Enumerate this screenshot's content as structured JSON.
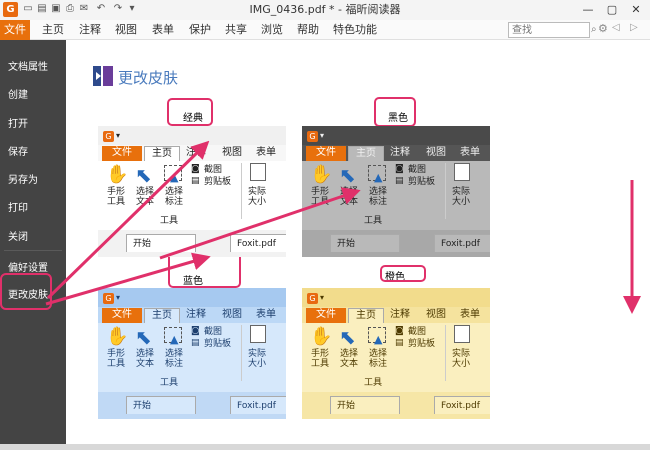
{
  "window": {
    "title": "IMG_0436.pdf * - 福昕阅读器",
    "logo": "G",
    "qa_icons": [
      "document-icon",
      "folder-icon",
      "save-icon",
      "print-icon",
      "email-icon",
      "undo-icon",
      "redo-icon",
      "dropdown-icon"
    ],
    "controls": [
      "minimize",
      "maximize",
      "close"
    ]
  },
  "menubar": {
    "file_label": "文件",
    "items": [
      "主页",
      "注释",
      "视图",
      "表单",
      "保护",
      "共享",
      "浏览",
      "帮助",
      "特色功能"
    ],
    "search_placeholder": "查找",
    "gear": "⚙"
  },
  "sidebar": {
    "items": [
      "文档属性",
      "创建",
      "打开",
      "保存",
      "另存为",
      "打印",
      "关闭",
      "偏好设置",
      "更改皮肤"
    ],
    "selected": "更改皮肤"
  },
  "page": {
    "title": "更改皮肤"
  },
  "skins": [
    {
      "name": "经典",
      "top_bg": "#f0f0f0",
      "tab_bg": "#f7f7f7",
      "ribbon_bg": "#ffffff",
      "bot_bg": "#f2f2f2",
      "text": "#222222",
      "home_bg": "#ffffff"
    },
    {
      "name": "黑色",
      "top_bg": "#4a4a4a",
      "tab_bg": "#555555",
      "ribbon_bg": "#b9b9b9",
      "bot_bg": "#a8a8a8",
      "text": "#f0f0f0",
      "home_bg": "#b9b9b9"
    },
    {
      "name": "蓝色",
      "top_bg": "#a6c9f0",
      "tab_bg": "#bcd8f6",
      "ribbon_bg": "#d6e8fb",
      "bot_bg": "#c0d9f5",
      "text": "#1d3f6e",
      "home_bg": "#d6e8fb"
    },
    {
      "name": "橙色",
      "top_bg": "#f2dc8c",
      "tab_bg": "#f5e39e",
      "ribbon_bg": "#faefbf",
      "bot_bg": "#f6e6a6",
      "text": "#4d3a00",
      "home_bg": "#faefbf"
    }
  ],
  "skin_ui": {
    "file": "文件",
    "home": "主页",
    "comment": "注释",
    "view": "视图",
    "table": "表单",
    "hand_l1": "手形",
    "hand_l2": "工具",
    "select_l1": "选择",
    "select_l2": "文本",
    "annot_l1": "选择",
    "annot_l2": "标注",
    "capture": "截图",
    "clipboard": "剪贴板",
    "actual_l1": "实际",
    "actual_l2": "大小",
    "tools_group": "工具",
    "doc_start": "开始",
    "doc_file": "Foxit.pdf"
  },
  "colors": {
    "accent": "#e8700c",
    "highlight": "#e0306a",
    "sidebar_bg": "#444444",
    "title_blue": "#4a7bbd"
  }
}
